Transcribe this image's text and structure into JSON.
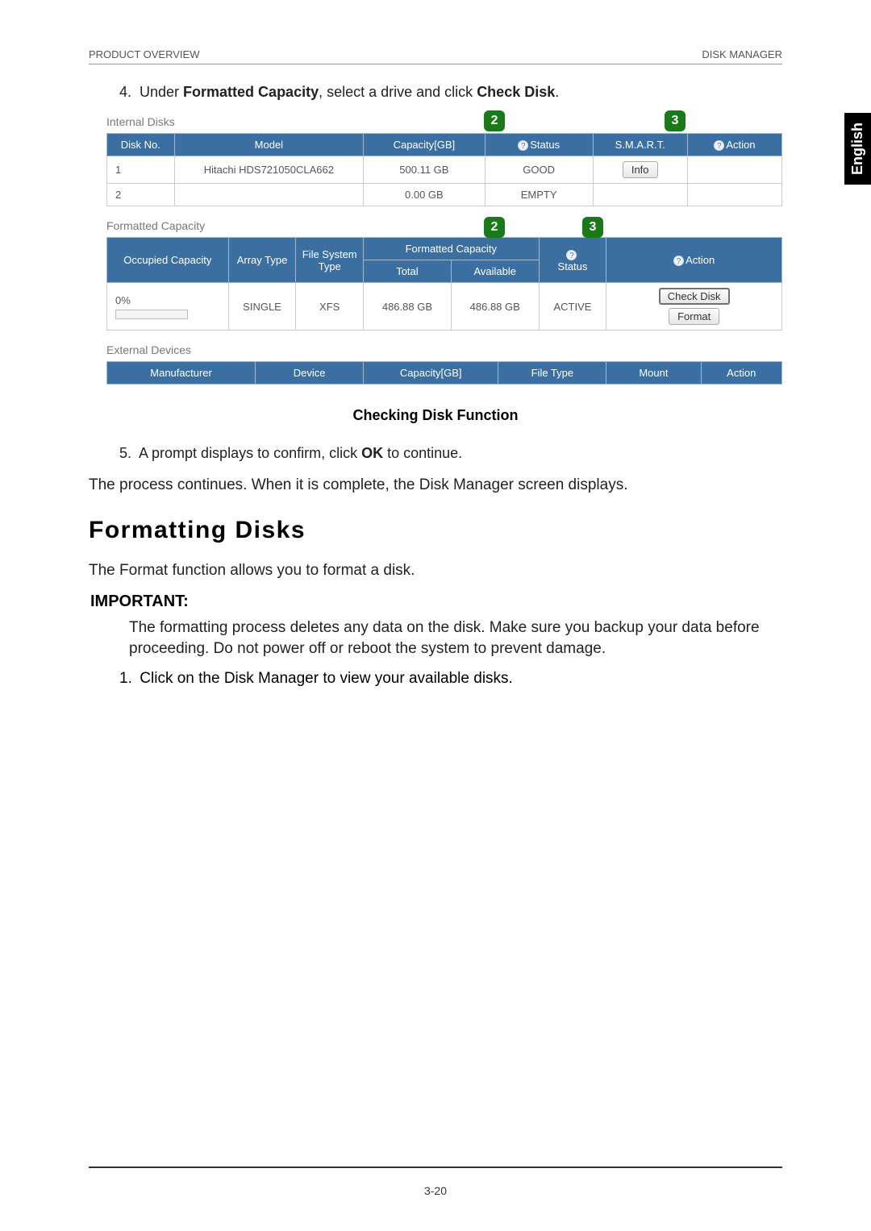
{
  "header": {
    "left": "PRODUCT OVERVIEW",
    "right": "DISK MANAGER"
  },
  "lang_tab": "English",
  "step4": {
    "num": "4.",
    "pre": "Under ",
    "b1": "Formatted Capacity",
    "mid": ", select a drive and click ",
    "b2": "Check Disk",
    "end": "."
  },
  "internal": {
    "title": "Internal Disks",
    "headers": {
      "diskno": "Disk No.",
      "model": "Model",
      "capacity": "Capacity[GB]",
      "status": "Status",
      "smart": "S.M.A.R.T.",
      "action": "Action"
    },
    "rows": [
      {
        "no": "1",
        "model": "Hitachi HDS721050CLA662",
        "capacity": "500.11 GB",
        "status": "GOOD",
        "smart_btn": "Info"
      },
      {
        "no": "2",
        "model": "",
        "capacity": "0.00 GB",
        "status": "EMPTY",
        "smart_btn": ""
      }
    ]
  },
  "formatted": {
    "title": "Formatted Capacity",
    "headers": {
      "occupied": "Occupied Capacity",
      "array": "Array Type",
      "fs": "File System Type",
      "fc": "Formatted Capacity",
      "total": "Total",
      "available": "Available",
      "status": "Status",
      "action": "Action"
    },
    "row": {
      "occ": "0%",
      "array": "SINGLE",
      "fs": "XFS",
      "total": "486.88 GB",
      "available": "486.88 GB",
      "status": "ACTIVE",
      "btn_check": "Check Disk",
      "btn_format": "Format"
    }
  },
  "external": {
    "title": "External Devices",
    "headers": {
      "manufacturer": "Manufacturer",
      "device": "Device",
      "capacity": "Capacity[GB]",
      "filetype": "File Type",
      "mount": "Mount",
      "action": "Action"
    }
  },
  "callouts": {
    "int_status": "2",
    "int_smart": "3",
    "fmt_status": "2",
    "fmt_action": "3"
  },
  "help_q": "?",
  "caption": "Checking Disk Function",
  "step5": {
    "num": "5.",
    "pre": "A prompt displays to confirm, click ",
    "b1": "OK",
    "end": " to continue."
  },
  "para_after5": "The process continues. When it is complete, the Disk Manager screen displays.",
  "h2": "Formatting Disks",
  "para_fmt": "The Format function allows you to format a disk.",
  "important_label": "IMPORTANT:",
  "important_body": "The formatting process deletes any data on the disk. Make sure you backup your data before proceeding. Do not power off or reboot the system to prevent damage.",
  "step_fmt1": {
    "num": "1.",
    "text": "Click on the Disk Manager to view your available disks."
  },
  "page_no": "3-20"
}
